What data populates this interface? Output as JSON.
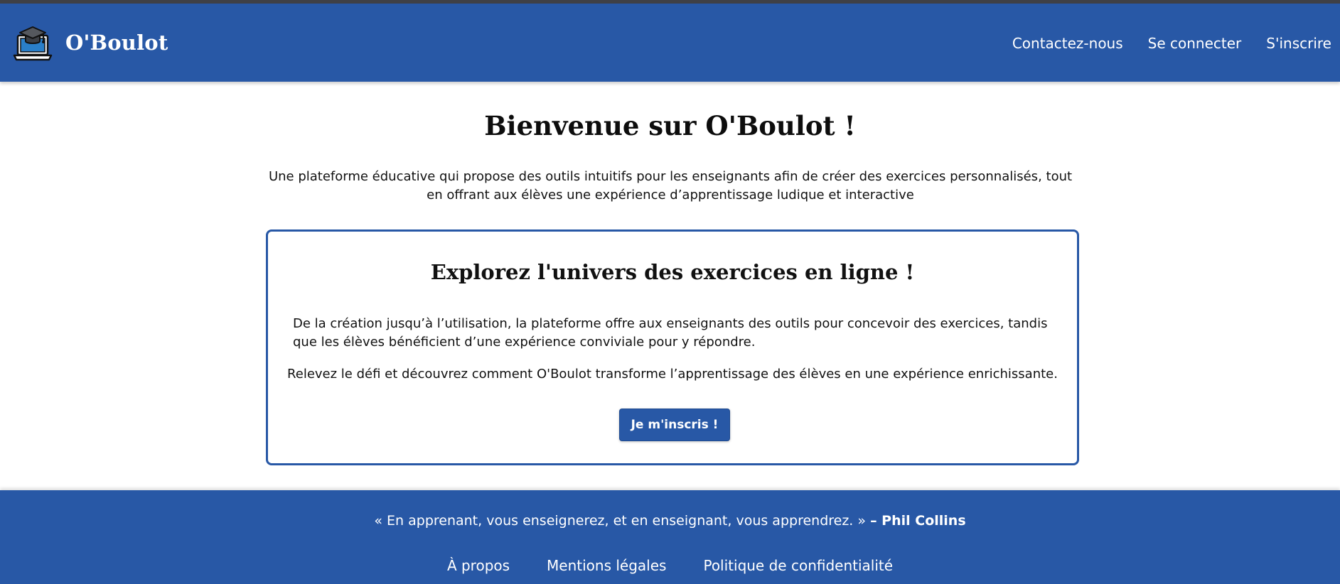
{
  "header": {
    "logo_icon": "laptop-graduation-cap-icon",
    "brand": "O'Boulot",
    "nav": [
      "Contactez-nous",
      "Se connecter",
      "S'inscrire"
    ]
  },
  "hero": {
    "title": "Bienvenue sur O'Boulot !",
    "text": "Une plateforme éducative qui propose des outils intuitifs pour les enseignants afin de créer des exercices personnalisés, tout en offrant aux élèves une expérience d’apprentissage ludique et interactive"
  },
  "card": {
    "title": "Explorez l'univers des exercices en ligne !",
    "paragraph1": "De la création jusqu’à l’utilisation, la plateforme offre aux enseignants des outils pour concevoir des exercices, tandis que les élèves bénéficient d’une expérience conviviale pour y répondre.",
    "paragraph2": "Relevez le défi et découvrez comment O'Boulot transforme l’apprentissage des élèves en une expérience enrichissante.",
    "cta_label": "Je m'inscris !"
  },
  "footer": {
    "quote": "« En apprenant, vous enseignerez, et en enseignant, vous apprendrez. »",
    "quote_author": "– Phil Collins",
    "links": [
      "À propos",
      "Mentions légales",
      "Politique de confidentialité"
    ]
  },
  "colors": {
    "primary": "#2858a6",
    "top_strip": "#3f4046",
    "background": "#ffffff"
  }
}
